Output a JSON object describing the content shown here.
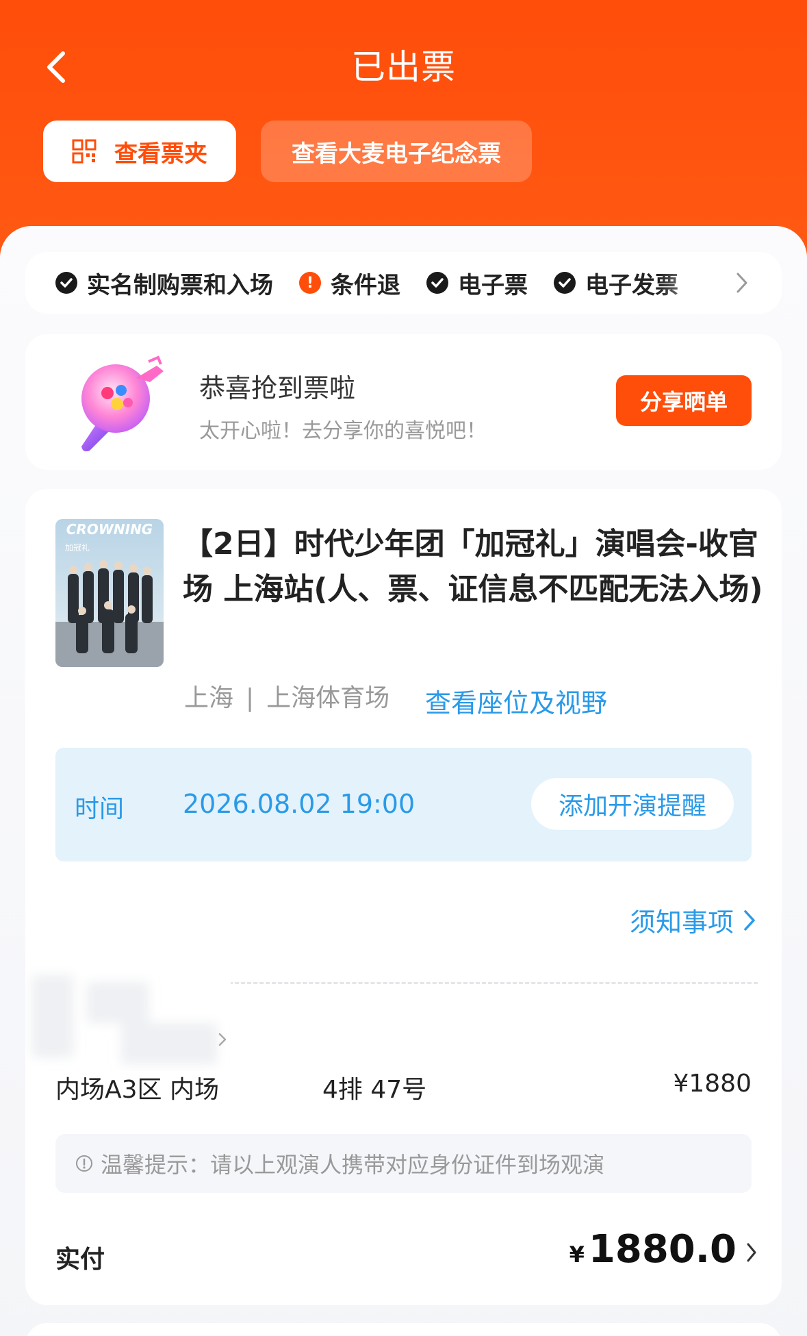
{
  "header": {
    "title": "已出票",
    "ticket_folder_label": "查看票夹",
    "souvenir_label": "查看大麦电子纪念票"
  },
  "features": {
    "items": [
      "实名制购票和入场",
      "条件退",
      "电子票",
      "电子发票"
    ]
  },
  "congrats": {
    "title": "恭喜抢到票啦",
    "subtitle": "太开心啦！去分享你的喜悦吧！",
    "share_label": "分享晒单"
  },
  "ticket": {
    "poster_text": "CROWNING",
    "poster_subtitle": "加冠礼",
    "title": "【2日】时代少年团「加冠礼」演唱会-收官场 上海站(人、票、证信息不匹配无法入场)",
    "city": "上海",
    "separator": "|",
    "venue": "上海体育场",
    "seat_view_link": "查看座位及视野",
    "time_label": "时间",
    "time_value": "2026.08.02 19:00",
    "reminder_label": "添加开演提醒",
    "notice_label": "须知事项",
    "seat_zone": "内场A3区 内场",
    "seat_number": "4排 47号",
    "seat_price": "¥1880",
    "tip": "温馨提示：请以上观演人携带对应身份证件到场观演",
    "paid_label": "实付",
    "paid_currency": "¥",
    "paid_amount": "1880.0"
  },
  "colors": {
    "brand": "#ff4d0a",
    "link": "#2a9ae8",
    "time_box_bg": "#e3f2fb"
  },
  "icons": [
    "back-icon",
    "qr-code-icon",
    "check-icon",
    "warning-icon",
    "chevron-right-icon",
    "info-icon"
  ]
}
